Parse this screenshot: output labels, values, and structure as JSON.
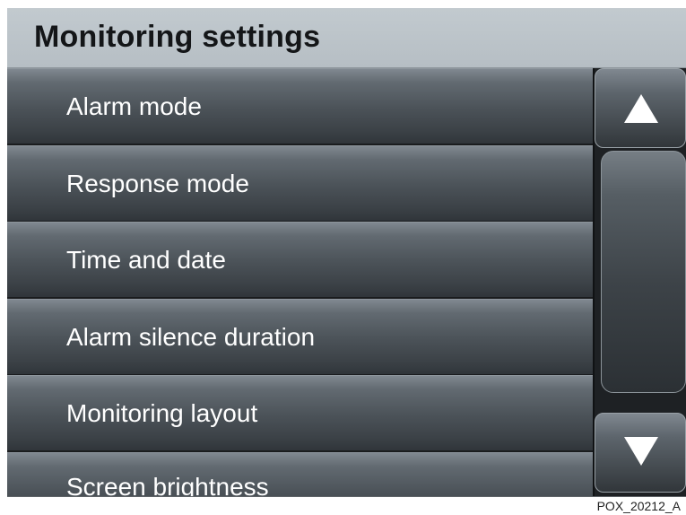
{
  "screen": {
    "title": "Monitoring settings",
    "caption": "POX_20212_A"
  },
  "menu": {
    "items": [
      {
        "label": "Alarm mode"
      },
      {
        "label": "Response mode"
      },
      {
        "label": "Time and date"
      },
      {
        "label": "Alarm silence duration"
      },
      {
        "label": "Monitoring layout"
      },
      {
        "label": "Screen brightness"
      }
    ]
  },
  "scrollbar": {
    "up_icon": "triangle-up-icon",
    "down_icon": "triangle-down-icon"
  },
  "colors": {
    "header_background": "#bac2c8",
    "item_background": "#4c5359",
    "text": "#ffffff",
    "title_text": "#141618"
  }
}
